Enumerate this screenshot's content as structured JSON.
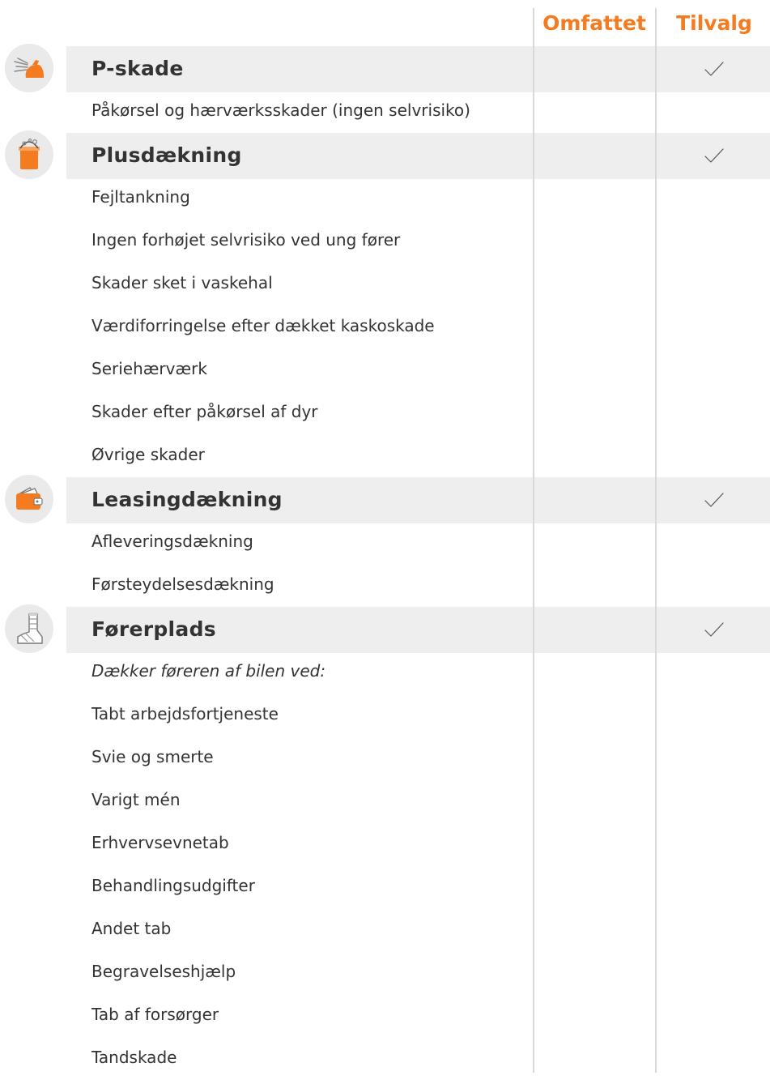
{
  "columns": {
    "included": "Omfattet",
    "optional": "Tilvalg"
  },
  "sections": [
    {
      "title": "P-skade",
      "icon": "spray-nozzle-icon",
      "optional_checked": true,
      "items": [
        {
          "text": "Påkørsel og hærværksskader (ingen selvrisiko)",
          "italic": false
        }
      ]
    },
    {
      "title": "Plusdækning",
      "icon": "bucket-icon",
      "optional_checked": true,
      "items": [
        {
          "text": "Fejltankning",
          "italic": false
        },
        {
          "text": "Ingen forhøjet selvrisiko ved ung fører",
          "italic": false
        },
        {
          "text": "Skader sket i vaskehal",
          "italic": false
        },
        {
          "text": "Værdiforringelse efter dækket kaskoskade",
          "italic": false
        },
        {
          "text": "Seriehærværk",
          "italic": false
        },
        {
          "text": "Skader efter påkørsel af dyr",
          "italic": false
        },
        {
          "text": "Øvrige skader",
          "italic": false
        }
      ]
    },
    {
      "title": "Leasingdækning",
      "icon": "wallet-icon",
      "optional_checked": true,
      "items": [
        {
          "text": "Afleveringsdækning",
          "italic": false
        },
        {
          "text": "Førsteydelsesdækning",
          "italic": false
        }
      ]
    },
    {
      "title": "Førerplads",
      "icon": "bandaged-foot-icon",
      "optional_checked": true,
      "items": [
        {
          "text": "Dækker føreren af bilen ved:",
          "italic": true
        },
        {
          "text": "Tabt arbejdsfortjeneste",
          "italic": false
        },
        {
          "text": "Svie og smerte",
          "italic": false
        },
        {
          "text": "Varigt mén",
          "italic": false
        },
        {
          "text": "Erhvervsevnetab",
          "italic": false
        },
        {
          "text": "Behandlingsudgifter",
          "italic": false
        },
        {
          "text": "Andet tab",
          "italic": false
        },
        {
          "text": "Begravelseshjælp",
          "italic": false
        },
        {
          "text": "Tab af forsørger",
          "italic": false
        },
        {
          "text": "Tandskade",
          "italic": false
        }
      ]
    }
  ],
  "colors": {
    "accent": "#f47b20",
    "band": "#eeeeee",
    "text": "#333333",
    "divider": "#d9d9d9"
  }
}
